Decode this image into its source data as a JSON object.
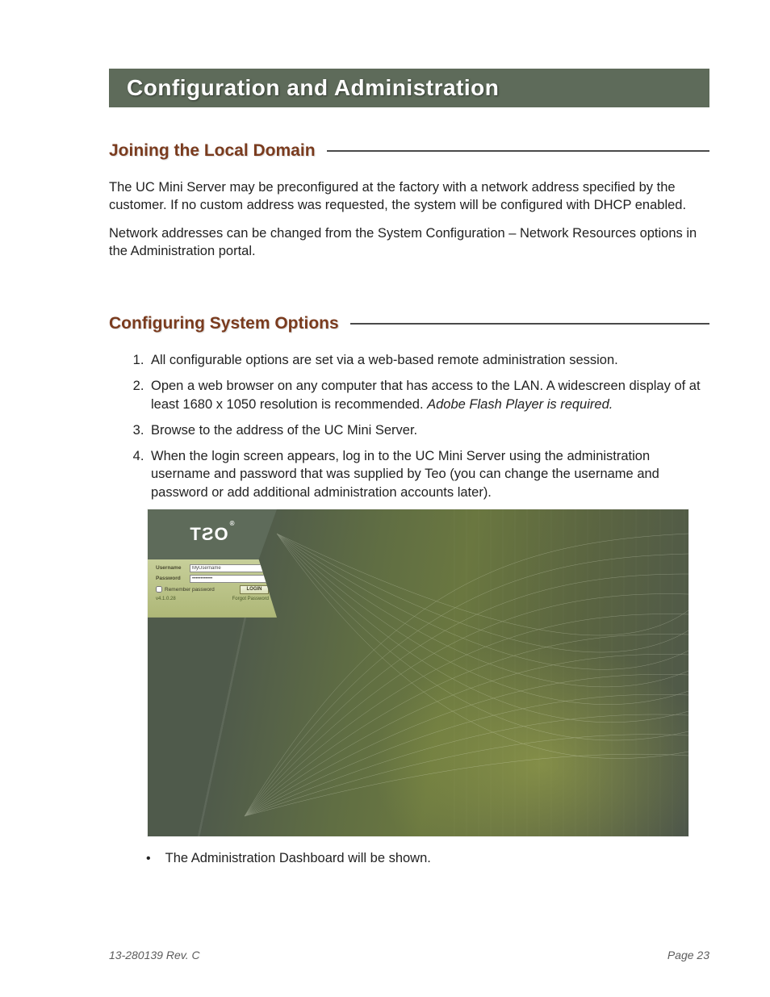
{
  "banner": {
    "title": "Configuration and Administration"
  },
  "section1": {
    "heading": "Joining the Local Domain",
    "p1": "The UC Mini Server may be preconfigured at the factory with a network address specified by the customer. If no custom address was requested, the system will be configured with DHCP enabled.",
    "p2": "Network addresses can be changed from the System Configuration – Network Resources options in the Administration portal."
  },
  "section2": {
    "heading": "Configuring System Options",
    "steps": [
      {
        "text": "All configurable options are set via a web-based remote administration session."
      },
      {
        "text": "Open a web browser on any computer that has access to the LAN. A widescreen display of at least 1680 x 1050 resolution is recommended. ",
        "ital": "Adobe Flash Player is required."
      },
      {
        "text": "Browse to the address of the UC Mini Server."
      },
      {
        "text": "When the login screen appears, log in to the UC Mini Server using the administration username and password that was supplied by Teo (you can change the username and password or add additional administration accounts later)."
      }
    ],
    "after_bullet": "The Administration Dashboard will be shown."
  },
  "login_screenshot": {
    "logo": "TƧO",
    "username_label": "Username",
    "username_value": "MyUsername",
    "password_label": "Password",
    "password_value": "••••••••••••",
    "remember_label": "Remember password",
    "login_button": "LOGIN",
    "version": "v4.1.0.28",
    "forgot": "Forgot Password"
  },
  "footer": {
    "left": "13-280139  Rev. C",
    "right": "Page 23"
  }
}
